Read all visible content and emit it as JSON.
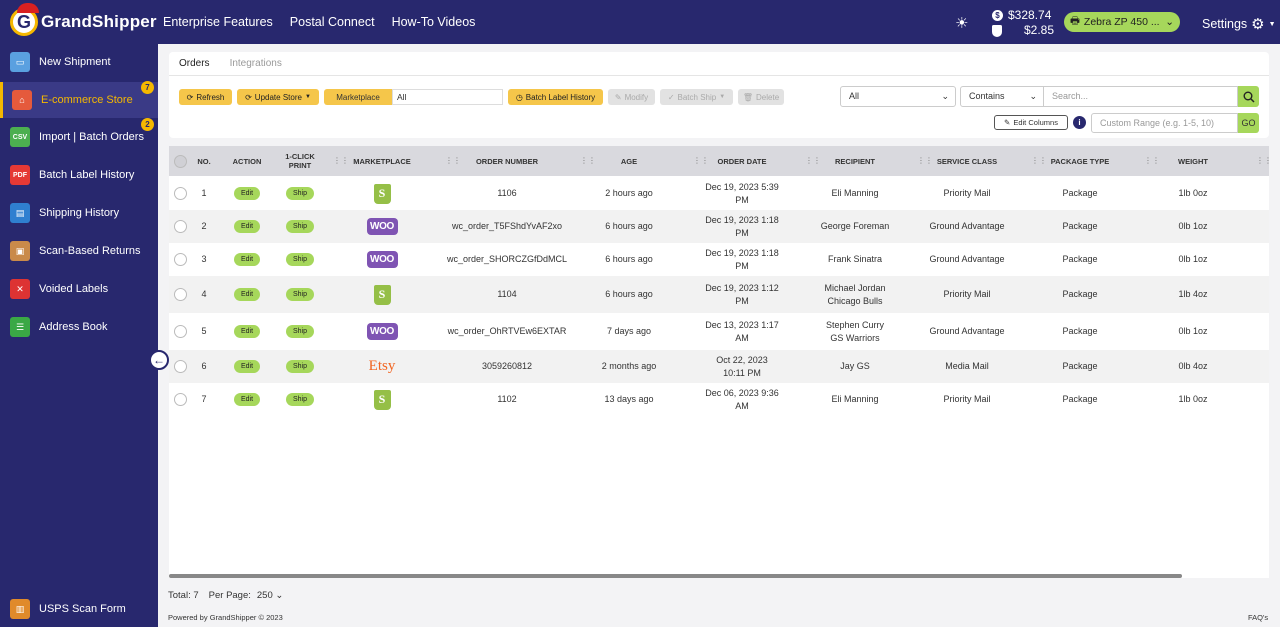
{
  "app": {
    "logo_letter": "G",
    "name": "GrandShipper"
  },
  "nav": {
    "items": [
      "Enterprise Features",
      "Postal Connect",
      "How-To Videos"
    ]
  },
  "header": {
    "balance_primary": "$328.74",
    "balance_secondary": "$2.85",
    "printer_label": "Zebra ZP 450 ...",
    "settings_label": "Settings"
  },
  "sidebar": {
    "items": [
      {
        "label": "New Shipment",
        "icon": "truck-icon",
        "color": "#5aa0e0"
      },
      {
        "label": "E-commerce Store",
        "icon": "store-icon",
        "color": "#e55a3c",
        "badge": "7"
      },
      {
        "label": "Import | Batch Orders",
        "icon": "csv-icon",
        "color": "#4caf50",
        "badge": "2"
      },
      {
        "label": "Batch Label History",
        "icon": "pdf-icon",
        "color": "#e53935"
      },
      {
        "label": "Shipping History",
        "icon": "forklift-icon",
        "color": "#2f7fd0"
      },
      {
        "label": "Scan-Based Returns",
        "icon": "box-icon",
        "color": "#c98a4a"
      },
      {
        "label": "Voided Labels",
        "icon": "void-shield-icon",
        "color": "#d33"
      },
      {
        "label": "Address Book",
        "icon": "address-book-icon",
        "color": "#3aa845"
      }
    ],
    "footer_item": {
      "label": "USPS Scan Form",
      "icon": "scan-form-icon",
      "color": "#e08a2a"
    }
  },
  "tabs": [
    {
      "label": "Orders",
      "active": true
    },
    {
      "label": "Integrations",
      "active": false
    }
  ],
  "toolbar": {
    "refresh": "Refresh",
    "update_store": "Update Store",
    "marketplace_label": "Marketplace",
    "marketplace_value": "All",
    "batch_label_history": "Batch Label History",
    "modify": "Modify",
    "batch_ship": "Batch Ship",
    "delete": "Delete"
  },
  "filters": {
    "field_value": "All",
    "operator_value": "Contains",
    "search_placeholder": "Search...",
    "edit_columns": "Edit Columns",
    "range_placeholder": "Custom Range (e.g. 1-5, 10)",
    "go_label": "GO"
  },
  "table": {
    "columns": [
      "NO.",
      "ACTION",
      "1-CLICK PRINT",
      "MARKETPLACE",
      "ORDER NUMBER",
      "AGE",
      "ORDER DATE",
      "RECIPIENT",
      "SERVICE CLASS",
      "PACKAGE TYPE",
      "WEIGHT"
    ],
    "edit_label": "Edit",
    "ship_label": "Ship",
    "rows": [
      {
        "no": "1",
        "marketplace": "shopify",
        "order": "1106",
        "age": "2 hours ago",
        "date": "Dec 19, 2023 5:39 PM",
        "recipient": "Eli Manning",
        "recipient2": "",
        "service": "Priority Mail",
        "package": "Package",
        "weight": "1lb 0oz"
      },
      {
        "no": "2",
        "marketplace": "woo",
        "order": "wc_order_T5FShdYvAF2xo",
        "age": "6 hours ago",
        "date": "Dec 19, 2023 1:18 PM",
        "recipient": "George Foreman",
        "recipient2": "",
        "service": "Ground Advantage",
        "package": "Package",
        "weight": "0lb 1oz"
      },
      {
        "no": "3",
        "marketplace": "woo",
        "order": "wc_order_SHORCZGfDdMCL",
        "age": "6 hours ago",
        "date": "Dec 19, 2023 1:18 PM",
        "recipient": "Frank Sinatra",
        "recipient2": "",
        "service": "Ground Advantage",
        "package": "Package",
        "weight": "0lb 1oz"
      },
      {
        "no": "4",
        "marketplace": "shopify",
        "order": "1104",
        "age": "6 hours ago",
        "date": "Dec 19, 2023 1:12 PM",
        "recipient": "Michael Jordan",
        "recipient2": "Chicago Bulls",
        "service": "Priority Mail",
        "package": "Package",
        "weight": "1lb 4oz"
      },
      {
        "no": "5",
        "marketplace": "woo",
        "order": "wc_order_OhRTVEw6EXTAR",
        "age": "7 days ago",
        "date": "Dec 13, 2023 1:17 AM",
        "recipient": "Stephen Curry",
        "recipient2": "GS Warriors",
        "service": "Ground Advantage",
        "package": "Package",
        "weight": "0lb 1oz"
      },
      {
        "no": "6",
        "marketplace": "etsy",
        "order": "3059260812",
        "age": "2 months ago",
        "date": "Oct 22, 2023 10:11 PM",
        "recipient": "Jay GS",
        "recipient2": "",
        "service": "Media Mail",
        "package": "Package",
        "weight": "0lb 4oz"
      },
      {
        "no": "7",
        "marketplace": "shopify",
        "order": "1102",
        "age": "13 days ago",
        "date": "Dec 06, 2023 9:36 AM",
        "recipient": "Eli Manning",
        "recipient2": "",
        "service": "Priority Mail",
        "package": "Package",
        "weight": "1lb 0oz"
      }
    ]
  },
  "marketplace_labels": {
    "woo": "WOO",
    "etsy": "Etsy",
    "shopify": "S"
  },
  "footer": {
    "total": "Total: 7",
    "per_page_label": "Per Page:",
    "per_page_value": "250",
    "powered": "Powered by GrandShipper © 2023",
    "faq": "FAQ's"
  }
}
